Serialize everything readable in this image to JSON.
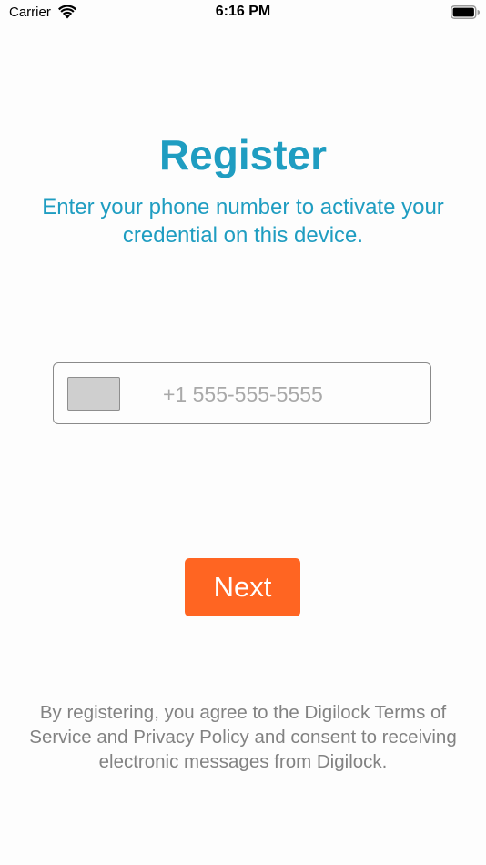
{
  "status_bar": {
    "carrier": "Carrier",
    "time": "6:16 PM",
    "icons": [
      "wifi-icon",
      "battery-icon"
    ]
  },
  "register": {
    "title": "Register",
    "subtitle": "Enter your phone number to activate your credential on this device."
  },
  "phone": {
    "country_flag": "country-flag-placeholder",
    "placeholder": "+1 555-555-5555",
    "value": ""
  },
  "actions": {
    "next_label": "Next"
  },
  "footer": {
    "terms": "By registering, you agree to the Digilock Terms of Service and Privacy Policy and consent to receiving electronic messages from Digilock."
  },
  "colors": {
    "accent": "#1f9dc1",
    "button": "#ff6522",
    "muted_text": "#828282",
    "background": "#fdfdfd"
  }
}
